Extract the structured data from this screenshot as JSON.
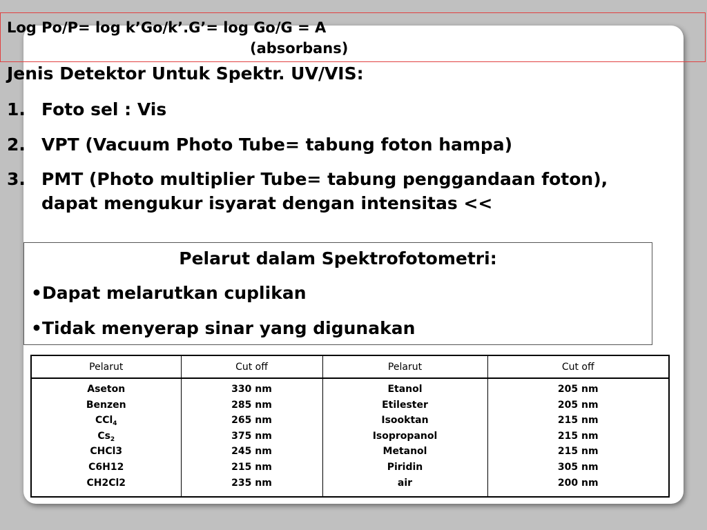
{
  "formula": {
    "line1": "Log Po/P= log k’Go/k’.G’= log Go/G = A",
    "line2": "(absorbans)"
  },
  "detectors": {
    "heading": "Jenis Detektor Untuk Spektr. UV/VIS:",
    "items": [
      {
        "num": "1.",
        "text": "Foto sel : Vis"
      },
      {
        "num": "2.",
        "text": "VPT (Vacuum Photo Tube= tabung foton hampa)"
      },
      {
        "num": "3.",
        "text": "PMT (Photo multiplier Tube= tabung penggandaan foton), dapat mengukur isyarat dengan intensitas <<"
      }
    ]
  },
  "solvents": {
    "title": "Pelarut dalam Spektrofotometri:",
    "bullets": [
      "•Dapat melarutkan cuplikan",
      "•Tidak menyerap sinar yang digunakan"
    ]
  },
  "table": {
    "headers": [
      "Pelarut",
      "Cut off",
      "Pelarut",
      "Cut off"
    ],
    "col1": [
      "Aseton",
      "Benzen",
      "CCl4",
      "Cs2",
      "CHCl3",
      "C6H12",
      "CH2Cl2"
    ],
    "col2": [
      "330 nm",
      "285 nm",
      "265 nm",
      "375 nm",
      "245 nm",
      "215 nm",
      "235 nm"
    ],
    "col3": [
      "Etanol",
      "Etilester",
      "Isooktan",
      "Isopropanol",
      "Metanol",
      "Piridin",
      "air"
    ],
    "col4": [
      "205 nm",
      "205 nm",
      "215 nm",
      "215 nm",
      "215 nm",
      "305 nm",
      "200 nm"
    ]
  }
}
